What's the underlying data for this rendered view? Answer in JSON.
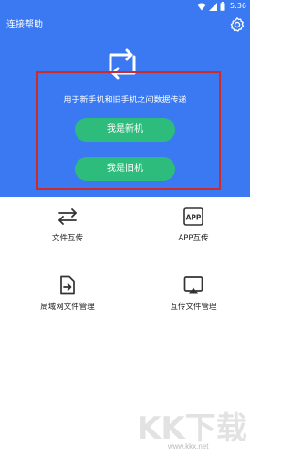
{
  "status_bar": {
    "time": "5:36",
    "icons": [
      "wifi-icon",
      "signal-icon",
      "battery-icon"
    ]
  },
  "header": {
    "title": "连接帮助",
    "subtitle": "用于新手机和旧手机之间数据传递",
    "btn_new": "我是新机",
    "btn_old": "我是旧机"
  },
  "features": {
    "file_transfer": "文件互传",
    "app_transfer": "APP互传",
    "app_icon_text": "APP",
    "lan_manage": "局域网文件管理",
    "mutual_manage": "互传文件管理"
  },
  "watermark": {
    "brand": "KK下载",
    "url": "www.kkx.net"
  },
  "colors": {
    "header": "#3a79f2",
    "button": "#2ebc7c",
    "highlight": "#cc2b2b"
  }
}
